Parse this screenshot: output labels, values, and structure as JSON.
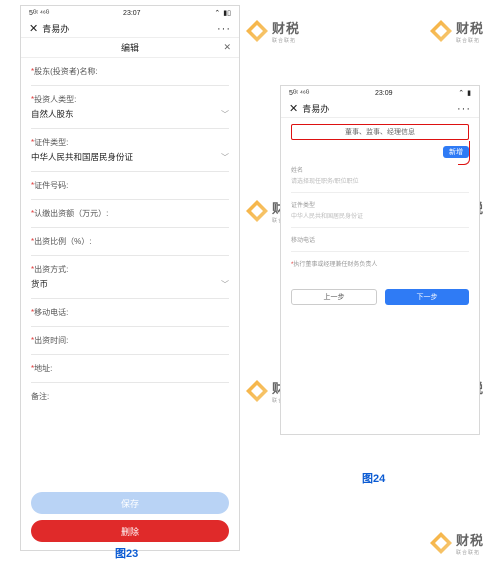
{
  "watermark": {
    "brand": "财税",
    "sub": "联合联拓"
  },
  "status": {
    "left_icons": "5ᴳᵗ ⁴⁶ᴳ",
    "wifi": "⌃",
    "time": "23:07",
    "battery": "▮▯",
    "sig": "▮"
  },
  "titlebar": {
    "back": "✕",
    "title": "青易办",
    "dots": "···"
  },
  "edit": {
    "label": "编辑",
    "close": "✕"
  },
  "form": {
    "f1": {
      "label": "股东(投资者)名称:"
    },
    "f2": {
      "label": "投资人类型:",
      "value": "自然人股东"
    },
    "f3": {
      "label": "证件类型:",
      "value": "中华人民共和国居民身份证"
    },
    "f4": {
      "label": "证件号码:"
    },
    "f5": {
      "label": "认缴出资额（万元）:"
    },
    "f6": {
      "label": "出资比例（%）:"
    },
    "f7": {
      "label": "出资方式:",
      "value": "货币"
    },
    "f8": {
      "label": "移动电话:"
    },
    "f9": {
      "label": "出资时间:"
    },
    "f10": {
      "label": "地址:"
    },
    "f11": {
      "label": "备注:"
    }
  },
  "buttons": {
    "save": "保存",
    "del": "删除"
  },
  "captions": {
    "c23": "图23",
    "c24": "图24"
  },
  "right": {
    "status_time": "23:09",
    "title": "青易办",
    "callout": "董事、监事、经理信息",
    "tag": "新增",
    "l1": "姓名",
    "l2": "请选择现任职务/职位职位",
    "l3": "证件类型",
    "l4": "中华人民共和国居民身份证",
    "l5": "移动电话",
    "l6": "执行董事或经理兼任财务负责人",
    "prev": "上一步",
    "next": "下一步"
  }
}
